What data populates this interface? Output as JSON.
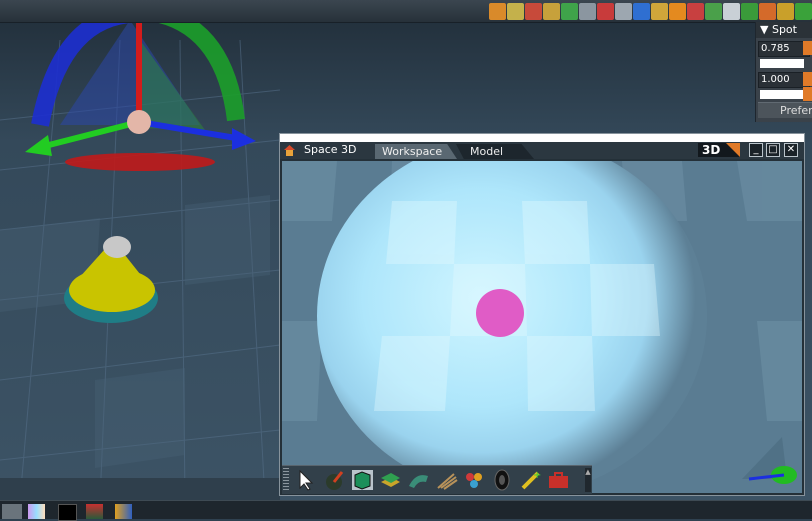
{
  "toolbar": {
    "icons": [
      "node-tool-icon",
      "rotate-tool-icon",
      "scale-tool-icon",
      "link-tool-icon",
      "orbit-tool-icon",
      "camera-tool-icon",
      "grid-tool-icon",
      "checker-tool-icon",
      "cube-tool-icon",
      "brush-tool-icon",
      "light-tool-icon",
      "paint-tool-icon",
      "house-tool-icon",
      "axis-tool-icon",
      "axis-l-icon",
      "axis-arrow-icon",
      "axis-y-icon",
      "axis-x-icon"
    ]
  },
  "properties_panel": {
    "title": "Spot",
    "value_1": "0.785",
    "value_2": "1.000",
    "preferences_label": "Prefere"
  },
  "window": {
    "title": "Space 3D",
    "tabs": [
      {
        "label": "Workspace",
        "active": true
      },
      {
        "label": "Model",
        "active": false
      }
    ],
    "view_mode": "3D",
    "buttons": {
      "minimize": "_",
      "maximize": "□",
      "close": "✕"
    }
  },
  "bottom_toolbar": {
    "icons": [
      "arrow-select-icon",
      "paint-ball-icon",
      "green-cube-icon",
      "stack-layers-icon",
      "deform-tool-icon",
      "cloth-tool-icon",
      "particles-icon",
      "tire-icon",
      "measure-tool-icon",
      "toolbox-icon"
    ]
  },
  "taskbar": {
    "icons": [
      "color-swatch-icon",
      "gradient-icon",
      "black-square-icon",
      "house-icon",
      "boxes-icon"
    ]
  },
  "colors": {
    "accent_orange": "#e07a28",
    "background_dark": "#2f4150",
    "spotlight": "#cdf4ff",
    "magenta_sphere": "#e05cc6",
    "cone_yellow": "#c9c400",
    "cone_teal": "#1f7d86"
  }
}
